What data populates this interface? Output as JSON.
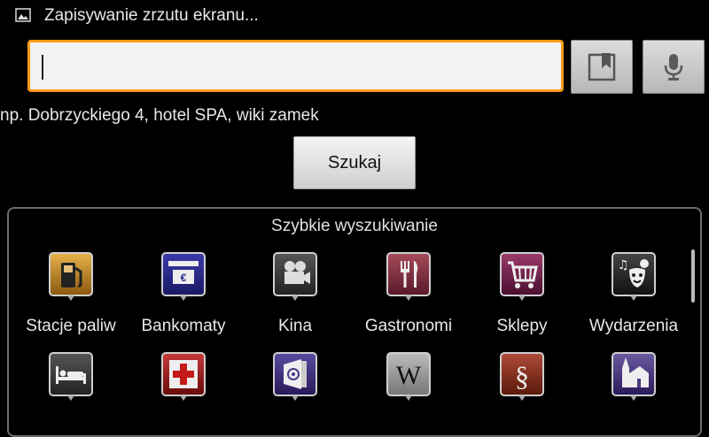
{
  "status": {
    "text": "Zapisywanie zrzutu ekranu...",
    "icon": "image-icon"
  },
  "search": {
    "value": "",
    "placeholder": "",
    "hint": "np. Dobrzyckiego 4, hotel SPA, wiki zamek"
  },
  "buttons": {
    "bookmark_icon": "bookmark-icon",
    "mic_icon": "microphone-icon",
    "search_label": "Szukaj"
  },
  "quick": {
    "title": "Szybkie wyszukiwanie",
    "row1": [
      {
        "label": "Stacje paliw",
        "icon": "fuel-pump-icon",
        "color": "#b07a1e"
      },
      {
        "label": "Bankomaty",
        "icon": "atm-icon",
        "color": "#2a2a8a"
      },
      {
        "label": "Kina",
        "icon": "film-camera-icon",
        "color": "#3a3a3a"
      },
      {
        "label": "Gastronomi",
        "icon": "fork-knife-icon",
        "color": "#7a2a3a"
      },
      {
        "label": "Sklepy",
        "icon": "shopping-cart-icon",
        "color": "#6a2040"
      },
      {
        "label": "Wydarzenia",
        "icon": "theater-masks-icon",
        "color": "#2e2e2e"
      }
    ],
    "row2": [
      {
        "icon": "bed-icon",
        "color": "#333333"
      },
      {
        "icon": "red-cross-icon",
        "color": "#9a1a1a"
      },
      {
        "icon": "safe-icon",
        "color": "#3a2a7a"
      },
      {
        "icon": "wikipedia-icon",
        "color": "#888888"
      },
      {
        "icon": "paragraph-icon",
        "color": "#8a2a1a"
      },
      {
        "icon": "church-icon",
        "color": "#4a3a7a"
      }
    ]
  }
}
